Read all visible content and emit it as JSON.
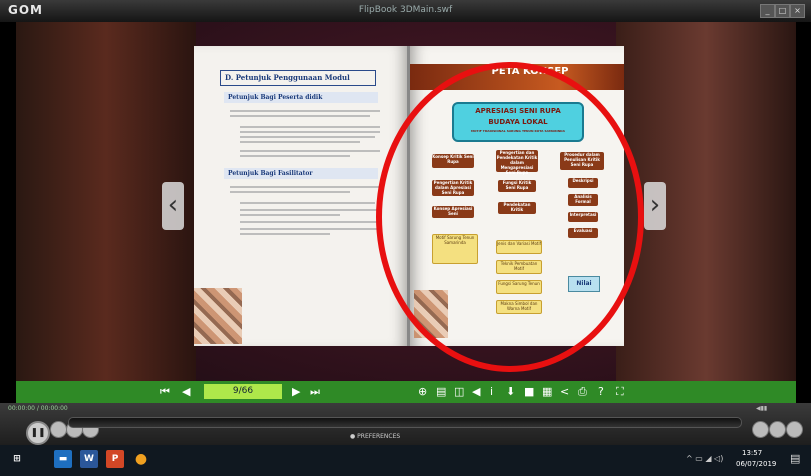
{
  "window": {
    "app": "GOM",
    "title": "FlipBook 3DMain.swf"
  },
  "book": {
    "left_page": {
      "header": "D. Petunjuk Penggunaan Modul",
      "section_1": "Petunjuk Bagi Peserta didik",
      "section_2": "Petunjuk Bagi Fasilitator"
    },
    "right_page": {
      "header": "PETA KONSEP",
      "title_line1": "APRESIASI SENI RUPA",
      "title_line2": "BUDAYA LOKAL",
      "title_line3": "MOTIF TRADISIONAL SARUNG TENUN KOTA SAMARINDA",
      "nodes": [
        "Konsep Kritik Seni Rupa",
        "Pengertian dan Pendekatan Kritik dalam Mengapresiasi Seni Rupa",
        "Prosedur dalam Penulisan Kritik Seni Rupa",
        "Pengertian Kritik dalam Apresiasi Seni Rupa",
        "Fungsi Kritik Seni Rupa",
        "Deskripsi",
        "Analisis Formal",
        "Interpretasi",
        "Evaluasi",
        "Konsep Apresiasi Seni",
        "Pendekatan Kritik",
        "Motif Sarung Tenun Samarinda",
        "Jenis dan Variasi Motif",
        "Teknik Pembuatan Motif",
        "Fungsi Sarung Tenun",
        "Makna Simbol dan Warna Motif"
      ],
      "result": "Nilai"
    }
  },
  "flipbook_toolbar": {
    "page_indicator": "9/66"
  },
  "player": {
    "time": "00:00:00 / 00:00:00",
    "preferences_label": "PREFERENCES"
  },
  "taskbar": {
    "clock_time": "13:57",
    "clock_date": "06/07/2019"
  },
  "colors": {
    "toolbar_green": "#2f8a26",
    "page_field": "#aee84a",
    "highlight_circle": "#e81010",
    "concept_title": "#4fd0e0"
  }
}
